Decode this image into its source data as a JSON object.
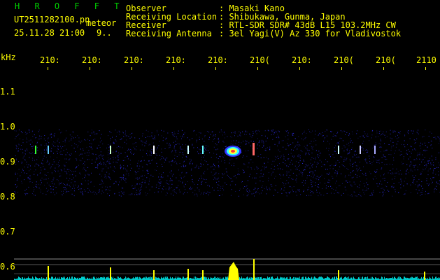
{
  "header": {
    "app_name": "H R O F F T",
    "filename": "UT2511282100.pn",
    "type": "meteor",
    "datetime": "25.11.28 21:00",
    "count": "9..",
    "info_labels": [
      "Observer",
      "Receiving Location",
      "Receiver",
      "Receiving Antenna"
    ],
    "info_values": [
      ": Masaki Kano",
      ": Shibukawa, Gunma, Japan",
      ": RTL-SDR SDR# 43dB L15 103.2MHz CW",
      ": 3el Yagi(V) Az 330 for Vladivostok"
    ]
  },
  "axis": {
    "unit": "kHz",
    "freq_labels": [
      "210:",
      "210:",
      "210:",
      "210:",
      "210:",
      "210(",
      "210:",
      "210(",
      "210(",
      "2110"
    ],
    "y_labels": [
      "1.1",
      "1.0",
      "0.9",
      "0.8",
      "0.7",
      "0.6"
    ]
  },
  "colors": {
    "text": "#ffff00",
    "title": "#00d000",
    "background": "#000000"
  }
}
